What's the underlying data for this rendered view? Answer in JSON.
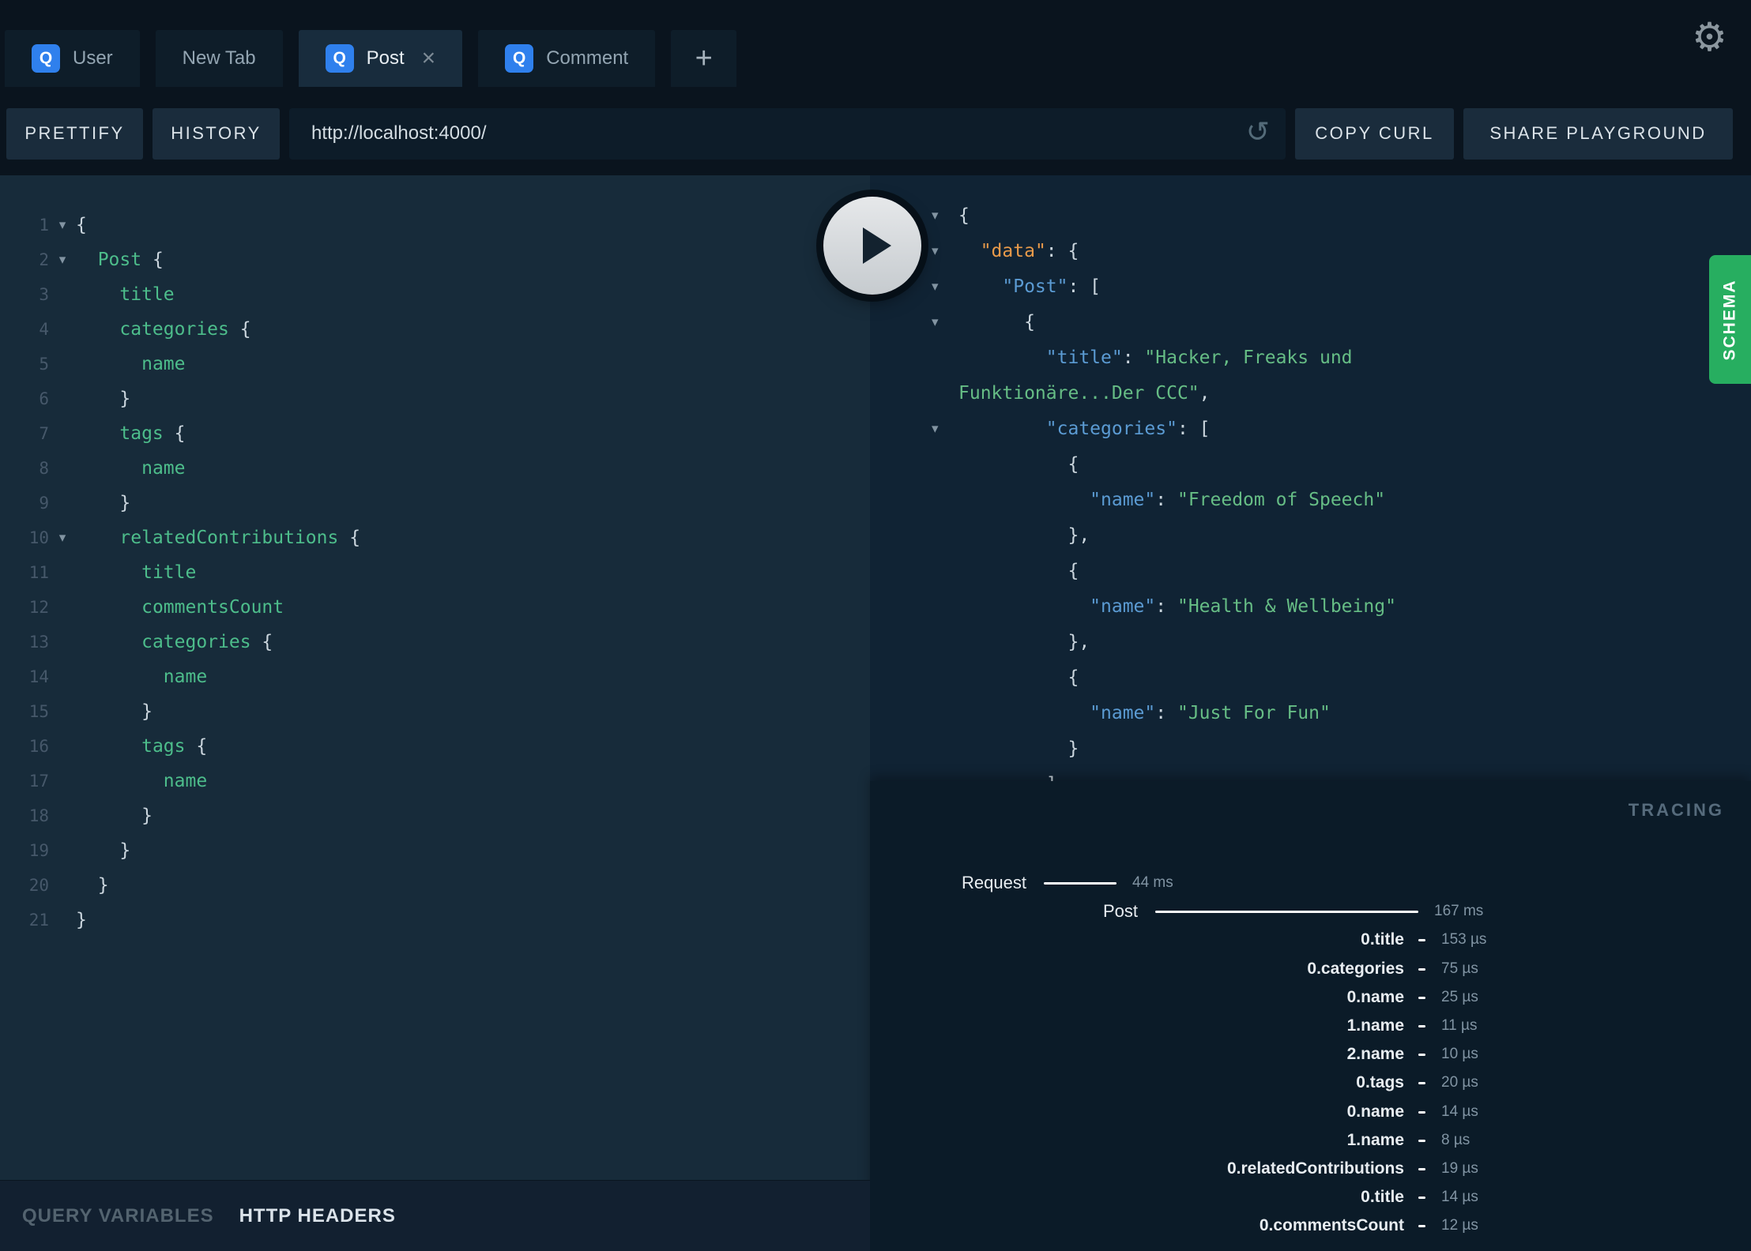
{
  "tabs": {
    "items": [
      {
        "badge": "Q",
        "label": "User",
        "active": false,
        "closable": false
      },
      {
        "badge": "",
        "label": "New Tab",
        "active": false,
        "closable": false
      },
      {
        "badge": "Q",
        "label": "Post",
        "active": true,
        "closable": true
      },
      {
        "badge": "Q",
        "label": "Comment",
        "active": false,
        "closable": false
      }
    ],
    "add_label": "+",
    "close_label": "×"
  },
  "toolbar": {
    "prettify_label": "PRETTIFY",
    "history_label": "HISTORY",
    "url_value": "http://localhost:4000/",
    "copy_curl_label": "COPY CURL",
    "share_label": "SHARE PLAYGROUND"
  },
  "icons": {
    "gear": "⚙",
    "reload": "↺",
    "fold": "▾"
  },
  "query_editor": {
    "lines": [
      {
        "num": 1,
        "fold": true,
        "tokens": [
          [
            "p",
            "{"
          ]
        ]
      },
      {
        "num": 2,
        "fold": true,
        "tokens": [
          [
            "p",
            "  "
          ],
          [
            "f",
            "Post"
          ],
          [
            "p",
            " {"
          ]
        ]
      },
      {
        "num": 3,
        "fold": false,
        "tokens": [
          [
            "p",
            "    "
          ],
          [
            "f",
            "title"
          ]
        ]
      },
      {
        "num": 4,
        "fold": false,
        "tokens": [
          [
            "p",
            "    "
          ],
          [
            "f",
            "categories"
          ],
          [
            "p",
            " {"
          ]
        ]
      },
      {
        "num": 5,
        "fold": false,
        "tokens": [
          [
            "p",
            "      "
          ],
          [
            "f",
            "name"
          ]
        ]
      },
      {
        "num": 6,
        "fold": false,
        "tokens": [
          [
            "p",
            "    }"
          ]
        ]
      },
      {
        "num": 7,
        "fold": false,
        "tokens": [
          [
            "p",
            "    "
          ],
          [
            "f",
            "tags"
          ],
          [
            "p",
            " {"
          ]
        ]
      },
      {
        "num": 8,
        "fold": false,
        "tokens": [
          [
            "p",
            "      "
          ],
          [
            "f",
            "name"
          ]
        ]
      },
      {
        "num": 9,
        "fold": false,
        "tokens": [
          [
            "p",
            "    }"
          ]
        ]
      },
      {
        "num": 10,
        "fold": true,
        "tokens": [
          [
            "p",
            "    "
          ],
          [
            "f",
            "relatedContributions"
          ],
          [
            "p",
            " {"
          ]
        ]
      },
      {
        "num": 11,
        "fold": false,
        "tokens": [
          [
            "p",
            "      "
          ],
          [
            "f",
            "title"
          ]
        ]
      },
      {
        "num": 12,
        "fold": false,
        "tokens": [
          [
            "p",
            "      "
          ],
          [
            "f",
            "commentsCount"
          ]
        ]
      },
      {
        "num": 13,
        "fold": false,
        "tokens": [
          [
            "p",
            "      "
          ],
          [
            "f",
            "categories"
          ],
          [
            "p",
            " {"
          ]
        ]
      },
      {
        "num": 14,
        "fold": false,
        "tokens": [
          [
            "p",
            "        "
          ],
          [
            "f",
            "name"
          ]
        ]
      },
      {
        "num": 15,
        "fold": false,
        "tokens": [
          [
            "p",
            "      }"
          ]
        ]
      },
      {
        "num": 16,
        "fold": false,
        "tokens": [
          [
            "p",
            "      "
          ],
          [
            "f",
            "tags"
          ],
          [
            "p",
            " {"
          ]
        ]
      },
      {
        "num": 17,
        "fold": false,
        "tokens": [
          [
            "p",
            "        "
          ],
          [
            "f",
            "name"
          ]
        ]
      },
      {
        "num": 18,
        "fold": false,
        "tokens": [
          [
            "p",
            "      }"
          ]
        ]
      },
      {
        "num": 19,
        "fold": false,
        "tokens": [
          [
            "p",
            "    }"
          ]
        ]
      },
      {
        "num": 20,
        "fold": false,
        "tokens": [
          [
            "p",
            "  }"
          ]
        ]
      },
      {
        "num": 21,
        "fold": false,
        "tokens": [
          [
            "p",
            "}"
          ]
        ]
      }
    ]
  },
  "response_viewer": {
    "rows": [
      {
        "fold": true,
        "tokens": [
          [
            "p",
            "{"
          ]
        ]
      },
      {
        "fold": true,
        "tokens": [
          [
            "p",
            "  "
          ],
          [
            "ko",
            "\"data\""
          ],
          [
            "p",
            ": {"
          ]
        ]
      },
      {
        "fold": true,
        "tokens": [
          [
            "p",
            "    "
          ],
          [
            "kb",
            "\"Post\""
          ],
          [
            "p",
            ": ["
          ]
        ]
      },
      {
        "fold": true,
        "tokens": [
          [
            "p",
            "      {"
          ]
        ]
      },
      {
        "fold": false,
        "tokens": [
          [
            "p",
            "        "
          ],
          [
            "kb",
            "\"title\""
          ],
          [
            "p",
            ": "
          ],
          [
            "s",
            "\"Hacker, Freaks und"
          ]
        ]
      },
      {
        "fold": false,
        "tokens": [
          [
            "s",
            "Funktionäre...Der CCC\""
          ],
          [
            "p",
            ","
          ]
        ]
      },
      {
        "fold": true,
        "tokens": [
          [
            "p",
            "        "
          ],
          [
            "kb",
            "\"categories\""
          ],
          [
            "p",
            ": ["
          ]
        ]
      },
      {
        "fold": false,
        "tokens": [
          [
            "p",
            "          {"
          ]
        ]
      },
      {
        "fold": false,
        "tokens": [
          [
            "p",
            "            "
          ],
          [
            "kb",
            "\"name\""
          ],
          [
            "p",
            ": "
          ],
          [
            "s",
            "\"Freedom of Speech\""
          ]
        ]
      },
      {
        "fold": false,
        "tokens": [
          [
            "p",
            "          },"
          ]
        ]
      },
      {
        "fold": false,
        "tokens": [
          [
            "p",
            "          {"
          ]
        ]
      },
      {
        "fold": false,
        "tokens": [
          [
            "p",
            "            "
          ],
          [
            "kb",
            "\"name\""
          ],
          [
            "p",
            ": "
          ],
          [
            "s",
            "\"Health & Wellbeing\""
          ]
        ]
      },
      {
        "fold": false,
        "tokens": [
          [
            "p",
            "          },"
          ]
        ]
      },
      {
        "fold": false,
        "tokens": [
          [
            "p",
            "          {"
          ]
        ]
      },
      {
        "fold": false,
        "tokens": [
          [
            "p",
            "            "
          ],
          [
            "kb",
            "\"name\""
          ],
          [
            "p",
            ": "
          ],
          [
            "s",
            "\"Just For Fun\""
          ]
        ]
      },
      {
        "fold": false,
        "tokens": [
          [
            "p",
            "          }"
          ]
        ]
      },
      {
        "fold": false,
        "tokens": [
          [
            "p",
            "        ]"
          ]
        ]
      }
    ]
  },
  "schema_tab_label": "SCHEMA",
  "tracing": {
    "title": "TRACING",
    "rows": [
      {
        "kind": "request",
        "label": "Request",
        "time": "44 ms"
      },
      {
        "kind": "root",
        "label": "Post",
        "time": "167 ms"
      },
      {
        "kind": "field",
        "label": "0.title",
        "time": "153 µs"
      },
      {
        "kind": "field",
        "label": "0.categories",
        "time": "75 µs"
      },
      {
        "kind": "field",
        "label": "0.name",
        "time": "25 µs"
      },
      {
        "kind": "field",
        "label": "1.name",
        "time": "11 µs"
      },
      {
        "kind": "field",
        "label": "2.name",
        "time": "10 µs"
      },
      {
        "kind": "field",
        "label": "0.tags",
        "time": "20 µs"
      },
      {
        "kind": "field",
        "label": "0.name",
        "time": "14 µs"
      },
      {
        "kind": "field",
        "label": "1.name",
        "time": "8 µs"
      },
      {
        "kind": "field",
        "label": "0.relatedContributions",
        "time": "19 µs"
      },
      {
        "kind": "field",
        "label": "0.title",
        "time": "14 µs"
      },
      {
        "kind": "field",
        "label": "0.commentsCount",
        "time": "12 µs"
      }
    ]
  },
  "footer": {
    "query_variables_label": "QUERY VARIABLES",
    "http_headers_label": "HTTP HEADERS"
  }
}
